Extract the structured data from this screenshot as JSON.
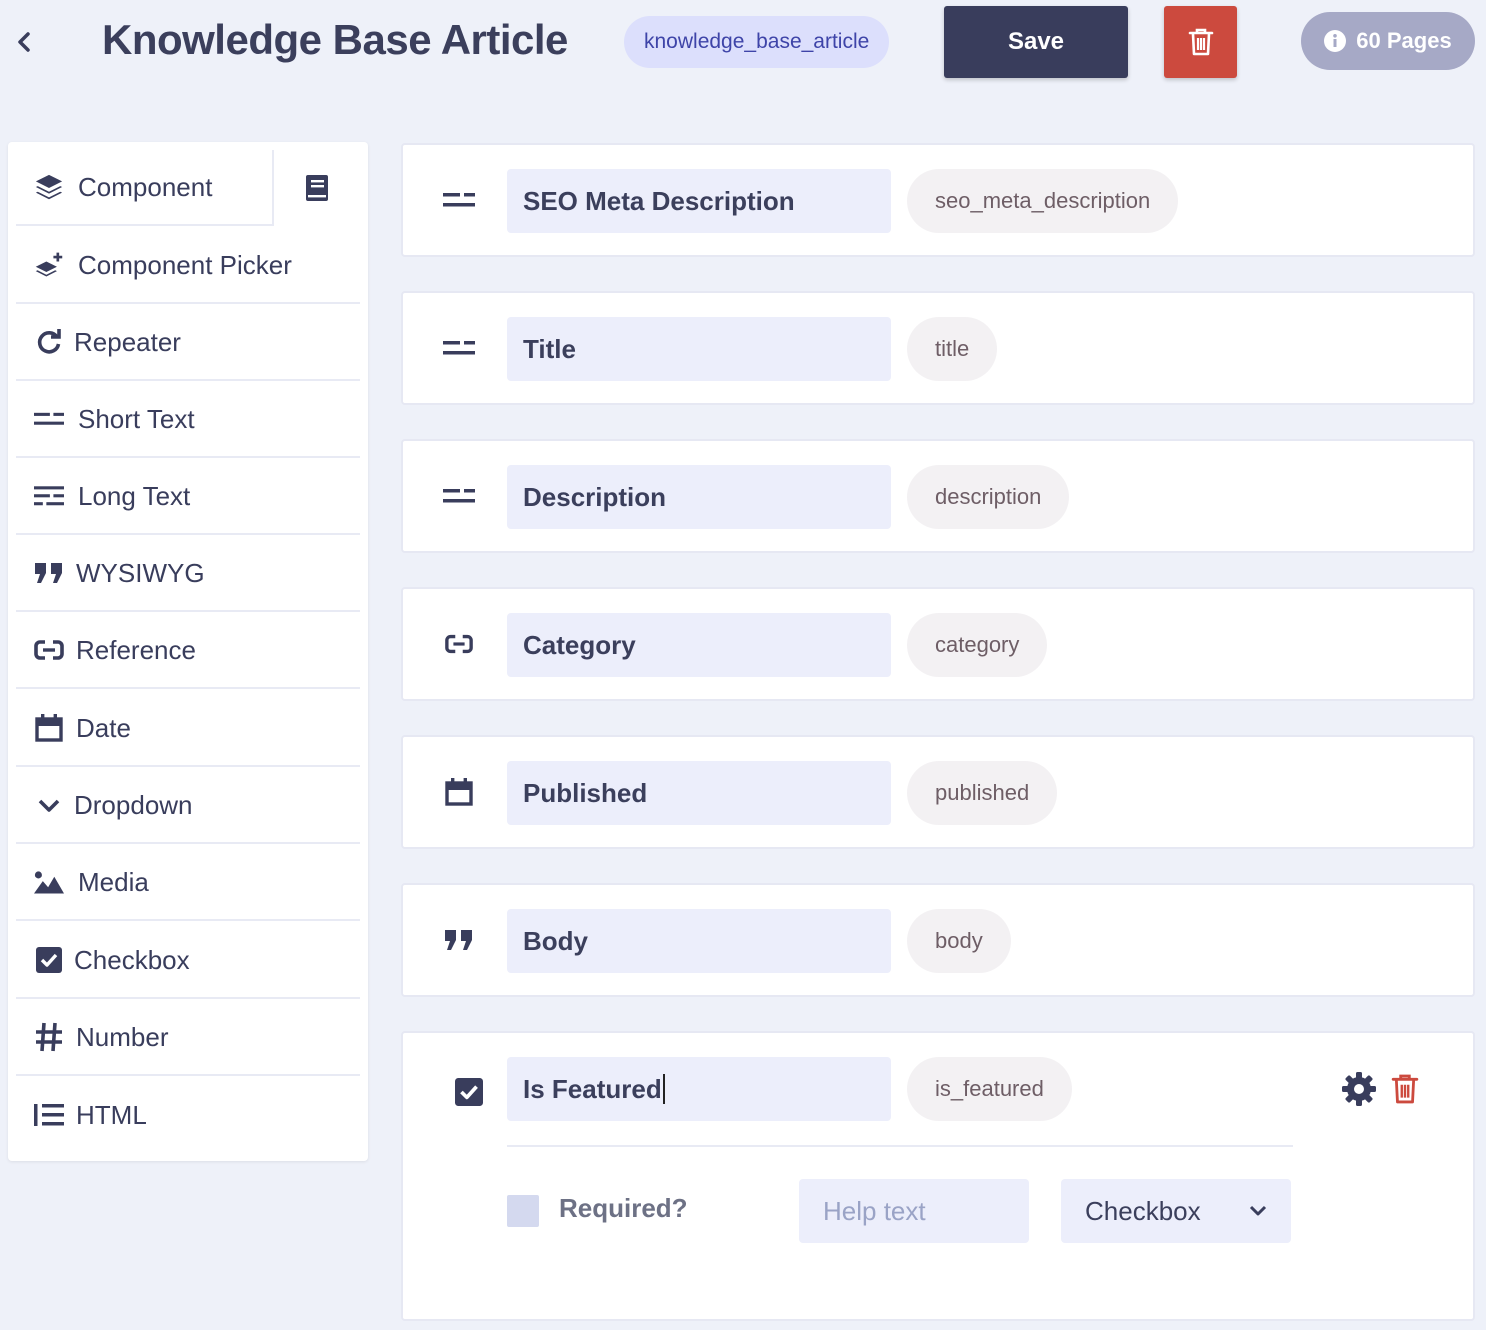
{
  "header": {
    "title": "Knowledge Base Article",
    "slug": "knowledge_base_article",
    "save_label": "Save",
    "pages_label": "60 Pages"
  },
  "sidebar": {
    "items": [
      {
        "label": "Component",
        "icon": "layers-icon"
      },
      {
        "label": "Component Picker",
        "icon": "layers-plus-icon"
      },
      {
        "label": "Repeater",
        "icon": "redo-icon"
      },
      {
        "label": "Short Text",
        "icon": "short-text-icon"
      },
      {
        "label": "Long Text",
        "icon": "long-text-icon"
      },
      {
        "label": "WYSIWYG",
        "icon": "quote-icon"
      },
      {
        "label": "Reference",
        "icon": "link-icon"
      },
      {
        "label": "Date",
        "icon": "calendar-icon"
      },
      {
        "label": "Dropdown",
        "icon": "chevron-down-icon"
      },
      {
        "label": "Media",
        "icon": "image-icon"
      },
      {
        "label": "Checkbox",
        "icon": "checkbox-icon"
      },
      {
        "label": "Number",
        "icon": "hash-icon"
      },
      {
        "label": "HTML",
        "icon": "list-icon"
      }
    ]
  },
  "fields": [
    {
      "name": "SEO Meta Description",
      "key": "seo_meta_description",
      "icon": "short-text-icon"
    },
    {
      "name": "Title",
      "key": "title",
      "icon": "short-text-icon"
    },
    {
      "name": "Description",
      "key": "description",
      "icon": "short-text-icon"
    },
    {
      "name": "Category",
      "key": "category",
      "icon": "link-icon"
    },
    {
      "name": "Published",
      "key": "published",
      "icon": "calendar-icon"
    },
    {
      "name": "Body",
      "key": "body",
      "icon": "quote-icon"
    },
    {
      "name": "Is Featured",
      "key": "is_featured",
      "icon": "checkbox-icon",
      "required_label": "Required?",
      "help_placeholder": "Help text",
      "type_value": "Checkbox"
    }
  ],
  "colors": {
    "background": "#eef1f9",
    "primary_dark": "#393d5c",
    "danger": "#cc4a3e",
    "slug_pill": "#dcdffc",
    "pages_pill": "#a6a9c6"
  }
}
